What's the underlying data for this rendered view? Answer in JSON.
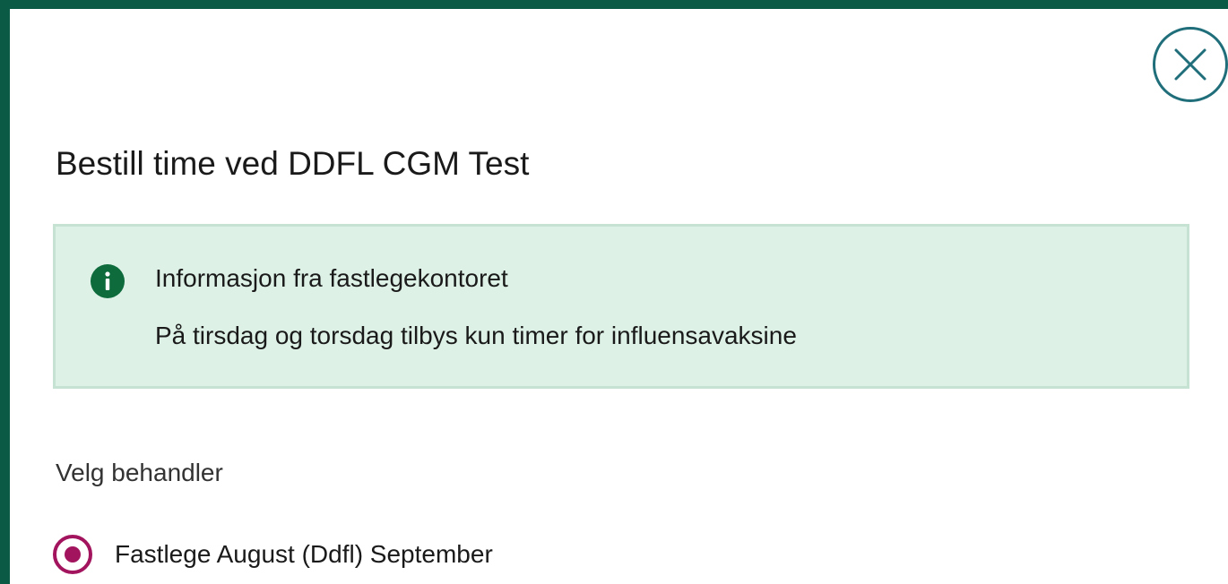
{
  "dialog": {
    "title": "Bestill time ved DDFL CGM Test",
    "close_icon": "close-icon"
  },
  "info": {
    "icon": "info-icon",
    "heading": "Informasjon fra fastlegekontoret",
    "body": "På tirsdag og torsdag tilbys kun timer for influensavaksine"
  },
  "practitioner": {
    "label": "Velg behandler",
    "options": [
      {
        "label": "Fastlege August (Ddfl) September",
        "selected": true
      }
    ]
  },
  "colors": {
    "frame": "#0b5a45",
    "close": "#1f6e7a",
    "info_background": "#ddf1e6",
    "info_icon": "#0d6b3c",
    "radio": "#a3145e"
  }
}
